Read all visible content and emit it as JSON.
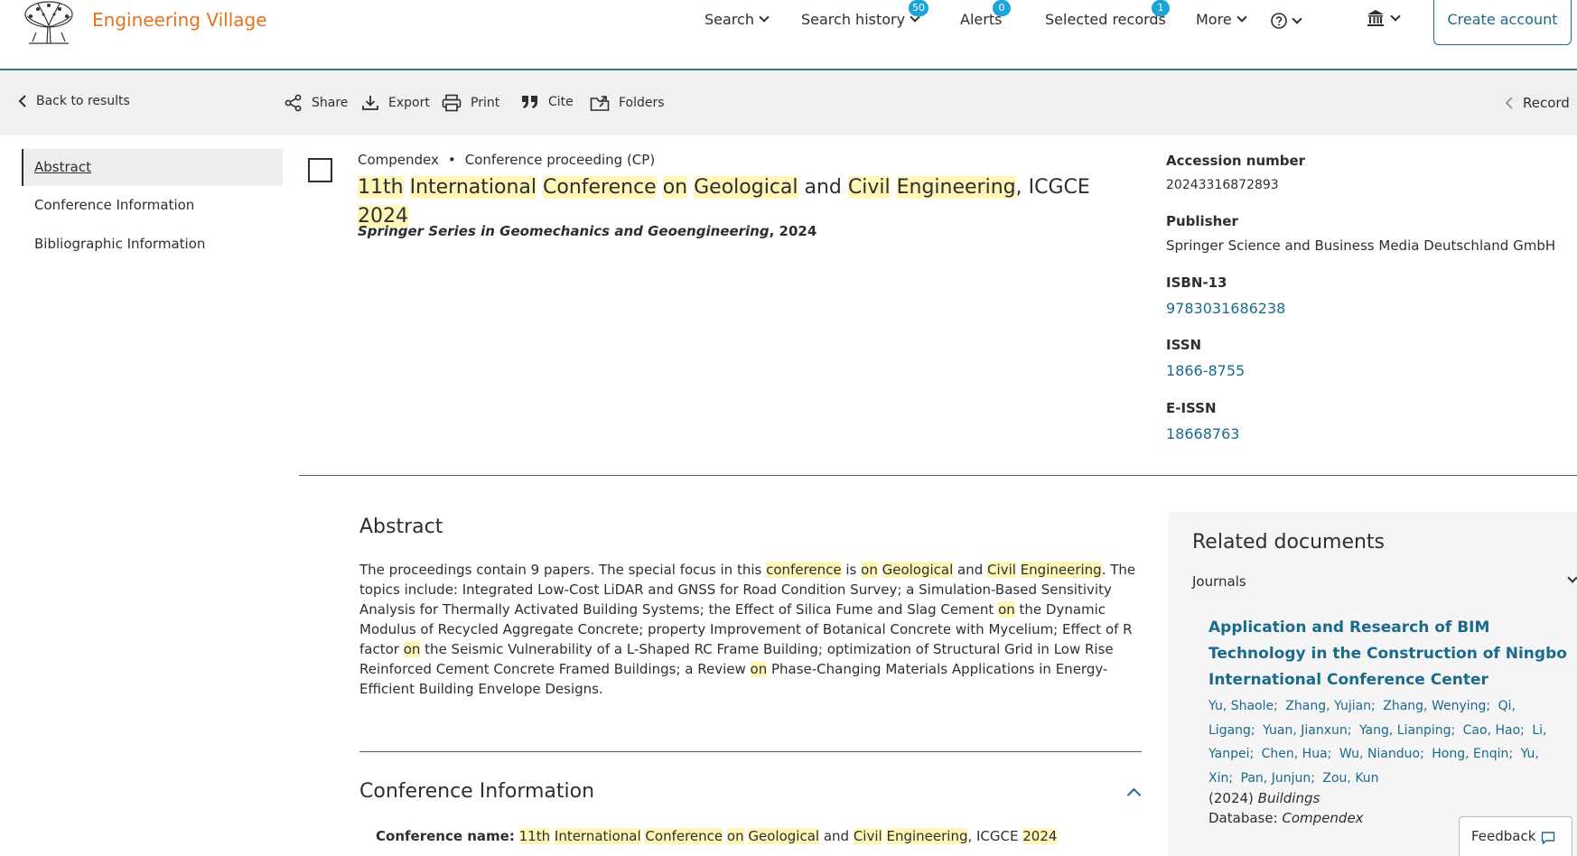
{
  "header": {
    "brand": "Engineering Village",
    "nav": [
      {
        "label": "Search",
        "badge": null
      },
      {
        "label": "Search history",
        "badge": "50"
      },
      {
        "label": "Alerts",
        "badge": "0"
      },
      {
        "label": "Selected records",
        "badge": "1"
      },
      {
        "label": "More",
        "badge": null
      }
    ],
    "help_icon": "question-circle-icon",
    "institution_icon": "institution-icon",
    "create_account": "Create account"
  },
  "toolbar": {
    "back": "Back to results",
    "share": "Share",
    "export": "Export",
    "print": "Print",
    "cite": "Cite",
    "folders": "Folders",
    "record": "Record"
  },
  "sidebar": {
    "items": [
      {
        "label": "Abstract",
        "active": true
      },
      {
        "label": "Conference Information",
        "active": false
      },
      {
        "label": "Bibliographic Information",
        "active": false
      }
    ]
  },
  "record": {
    "database": "Compendex",
    "doc_type": "Conference proceeding (CP)",
    "title_parts": [
      {
        "text": "11th",
        "hl": true
      },
      {
        "text": " ",
        "hl": false
      },
      {
        "text": "International",
        "hl": true
      },
      {
        "text": " ",
        "hl": false
      },
      {
        "text": "Conference",
        "hl": true
      },
      {
        "text": " ",
        "hl": false
      },
      {
        "text": "on",
        "hl": true
      },
      {
        "text": " ",
        "hl": false
      },
      {
        "text": "Geological",
        "hl": true
      },
      {
        "text": " and ",
        "hl": false
      },
      {
        "text": "Civil",
        "hl": true
      },
      {
        "text": " ",
        "hl": false
      },
      {
        "text": "Engineering",
        "hl": true
      },
      {
        "text": ", ICGCE ",
        "hl": false
      },
      {
        "text": "2024",
        "hl": true
      }
    ],
    "series_title": "Springer Series in Geomechanics and Geoengineering",
    "series_year": ", 2024"
  },
  "details": {
    "accession_label": "Accession number",
    "accession_value": "20243316872893",
    "publisher_label": "Publisher",
    "publisher_value": "Springer Science and Business Media Deutschland GmbH",
    "isbn_label": "ISBN-13",
    "isbn_value": "9783031686238",
    "issn_label": "ISSN",
    "issn_value": "1866-8755",
    "eissn_label": "E-ISSN",
    "eissn_value": "18668763"
  },
  "abstract": {
    "heading": "Abstract",
    "parts": [
      {
        "text": "The proceedings contain 9 papers. The special focus in this ",
        "hl": false
      },
      {
        "text": "conference",
        "hl": true
      },
      {
        "text": " is ",
        "hl": false
      },
      {
        "text": "on",
        "hl": true
      },
      {
        "text": " ",
        "hl": false
      },
      {
        "text": "Geological",
        "hl": true
      },
      {
        "text": " and ",
        "hl": false
      },
      {
        "text": "Civil",
        "hl": true
      },
      {
        "text": " ",
        "hl": false
      },
      {
        "text": "Engineering",
        "hl": true
      },
      {
        "text": ". The topics include: Integrated Low-Cost LiDAR and GNSS for Road Condition Survey; a Simulation-Based Sensitivity Analysis for Thermally Activated Building Systems; the Effect of Silica Fume and Slag Cement ",
        "hl": false
      },
      {
        "text": "on",
        "hl": true
      },
      {
        "text": " the Dynamic Modulus of Recycled Aggregate Concrete; property Improvement of Botanical Concrete with Mycelium; Effect of R factor ",
        "hl": false
      },
      {
        "text": "on",
        "hl": true
      },
      {
        "text": " the Seismic Vulnerability of a L-Shaped RC Frame Building; optimization of Structural Grid in Low Rise Reinforced Cement Concrete Framed Buildings; a Review ",
        "hl": false
      },
      {
        "text": "on",
        "hl": true
      },
      {
        "text": " Phase-Changing Materials Applications in Energy-Efficient Building Envelope Designs.",
        "hl": false
      }
    ]
  },
  "conference": {
    "heading": "Conference Information",
    "name_label": "Conference name:",
    "name_parts": [
      {
        "text": "11th",
        "hl": true
      },
      {
        "text": " ",
        "hl": false
      },
      {
        "text": "International",
        "hl": true
      },
      {
        "text": " ",
        "hl": false
      },
      {
        "text": "Conference",
        "hl": true
      },
      {
        "text": " ",
        "hl": false
      },
      {
        "text": "on",
        "hl": true
      },
      {
        "text": " ",
        "hl": false
      },
      {
        "text": "Geological",
        "hl": true
      },
      {
        "text": " and ",
        "hl": false
      },
      {
        "text": "Civil",
        "hl": true
      },
      {
        "text": " ",
        "hl": false
      },
      {
        "text": "Engineering",
        "hl": true
      },
      {
        "text": ", ICGCE ",
        "hl": false
      },
      {
        "text": "2024",
        "hl": true
      }
    ]
  },
  "related": {
    "heading": "Related documents",
    "tab": "Journals",
    "doc_title": "Application and Research of BIM Technology in the Construction of Ningbo International Conference Center",
    "authors": [
      "Yu, Shaole;",
      "Zhang, Yujian;",
      "Zhang, Wenying;",
      "Qi, Ligang;",
      "Yuan, Jianxun;",
      "Yang, Lianping;",
      "Cao, Hao;",
      "Li, Yanpei;",
      "Chen, Hua;",
      "Wu, Nianduo;",
      "Hong, Enqin;",
      "Yu, Xin;",
      "Pan, Junjun;",
      "Zou, Kun"
    ],
    "year": "(2024) ",
    "journal": "Buildings",
    "database_label": "Database: ",
    "database": "Compendex"
  },
  "feedback": "Feedback",
  "colors": {
    "brand": "#e9711c",
    "link": "#1a6a8c",
    "highlight": "#fff6b8",
    "badge": "#1aa4d8",
    "header_rule": "#2e7d7a"
  }
}
